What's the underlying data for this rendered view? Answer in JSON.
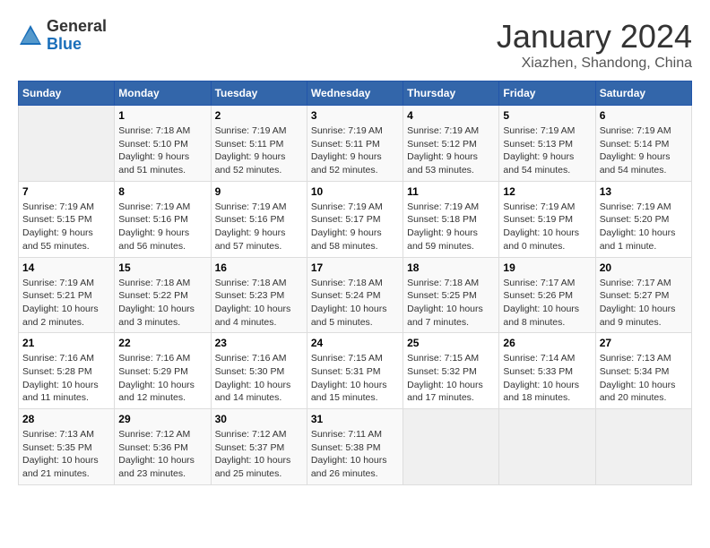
{
  "header": {
    "logo": {
      "general": "General",
      "blue": "Blue"
    },
    "title": "January 2024",
    "location": "Xiazhen, Shandong, China"
  },
  "days_of_week": [
    "Sunday",
    "Monday",
    "Tuesday",
    "Wednesday",
    "Thursday",
    "Friday",
    "Saturday"
  ],
  "weeks": [
    [
      {
        "day": "",
        "info": ""
      },
      {
        "day": "1",
        "info": "Sunrise: 7:18 AM\nSunset: 5:10 PM\nDaylight: 9 hours\nand 51 minutes."
      },
      {
        "day": "2",
        "info": "Sunrise: 7:19 AM\nSunset: 5:11 PM\nDaylight: 9 hours\nand 52 minutes."
      },
      {
        "day": "3",
        "info": "Sunrise: 7:19 AM\nSunset: 5:11 PM\nDaylight: 9 hours\nand 52 minutes."
      },
      {
        "day": "4",
        "info": "Sunrise: 7:19 AM\nSunset: 5:12 PM\nDaylight: 9 hours\nand 53 minutes."
      },
      {
        "day": "5",
        "info": "Sunrise: 7:19 AM\nSunset: 5:13 PM\nDaylight: 9 hours\nand 54 minutes."
      },
      {
        "day": "6",
        "info": "Sunrise: 7:19 AM\nSunset: 5:14 PM\nDaylight: 9 hours\nand 54 minutes."
      }
    ],
    [
      {
        "day": "7",
        "info": "Sunrise: 7:19 AM\nSunset: 5:15 PM\nDaylight: 9 hours\nand 55 minutes."
      },
      {
        "day": "8",
        "info": "Sunrise: 7:19 AM\nSunset: 5:16 PM\nDaylight: 9 hours\nand 56 minutes."
      },
      {
        "day": "9",
        "info": "Sunrise: 7:19 AM\nSunset: 5:16 PM\nDaylight: 9 hours\nand 57 minutes."
      },
      {
        "day": "10",
        "info": "Sunrise: 7:19 AM\nSunset: 5:17 PM\nDaylight: 9 hours\nand 58 minutes."
      },
      {
        "day": "11",
        "info": "Sunrise: 7:19 AM\nSunset: 5:18 PM\nDaylight: 9 hours\nand 59 minutes."
      },
      {
        "day": "12",
        "info": "Sunrise: 7:19 AM\nSunset: 5:19 PM\nDaylight: 10 hours\nand 0 minutes."
      },
      {
        "day": "13",
        "info": "Sunrise: 7:19 AM\nSunset: 5:20 PM\nDaylight: 10 hours\nand 1 minute."
      }
    ],
    [
      {
        "day": "14",
        "info": "Sunrise: 7:19 AM\nSunset: 5:21 PM\nDaylight: 10 hours\nand 2 minutes."
      },
      {
        "day": "15",
        "info": "Sunrise: 7:18 AM\nSunset: 5:22 PM\nDaylight: 10 hours\nand 3 minutes."
      },
      {
        "day": "16",
        "info": "Sunrise: 7:18 AM\nSunset: 5:23 PM\nDaylight: 10 hours\nand 4 minutes."
      },
      {
        "day": "17",
        "info": "Sunrise: 7:18 AM\nSunset: 5:24 PM\nDaylight: 10 hours\nand 5 minutes."
      },
      {
        "day": "18",
        "info": "Sunrise: 7:18 AM\nSunset: 5:25 PM\nDaylight: 10 hours\nand 7 minutes."
      },
      {
        "day": "19",
        "info": "Sunrise: 7:17 AM\nSunset: 5:26 PM\nDaylight: 10 hours\nand 8 minutes."
      },
      {
        "day": "20",
        "info": "Sunrise: 7:17 AM\nSunset: 5:27 PM\nDaylight: 10 hours\nand 9 minutes."
      }
    ],
    [
      {
        "day": "21",
        "info": "Sunrise: 7:16 AM\nSunset: 5:28 PM\nDaylight: 10 hours\nand 11 minutes."
      },
      {
        "day": "22",
        "info": "Sunrise: 7:16 AM\nSunset: 5:29 PM\nDaylight: 10 hours\nand 12 minutes."
      },
      {
        "day": "23",
        "info": "Sunrise: 7:16 AM\nSunset: 5:30 PM\nDaylight: 10 hours\nand 14 minutes."
      },
      {
        "day": "24",
        "info": "Sunrise: 7:15 AM\nSunset: 5:31 PM\nDaylight: 10 hours\nand 15 minutes."
      },
      {
        "day": "25",
        "info": "Sunrise: 7:15 AM\nSunset: 5:32 PM\nDaylight: 10 hours\nand 17 minutes."
      },
      {
        "day": "26",
        "info": "Sunrise: 7:14 AM\nSunset: 5:33 PM\nDaylight: 10 hours\nand 18 minutes."
      },
      {
        "day": "27",
        "info": "Sunrise: 7:13 AM\nSunset: 5:34 PM\nDaylight: 10 hours\nand 20 minutes."
      }
    ],
    [
      {
        "day": "28",
        "info": "Sunrise: 7:13 AM\nSunset: 5:35 PM\nDaylight: 10 hours\nand 21 minutes."
      },
      {
        "day": "29",
        "info": "Sunrise: 7:12 AM\nSunset: 5:36 PM\nDaylight: 10 hours\nand 23 minutes."
      },
      {
        "day": "30",
        "info": "Sunrise: 7:12 AM\nSunset: 5:37 PM\nDaylight: 10 hours\nand 25 minutes."
      },
      {
        "day": "31",
        "info": "Sunrise: 7:11 AM\nSunset: 5:38 PM\nDaylight: 10 hours\nand 26 minutes."
      },
      {
        "day": "",
        "info": ""
      },
      {
        "day": "",
        "info": ""
      },
      {
        "day": "",
        "info": ""
      }
    ]
  ]
}
